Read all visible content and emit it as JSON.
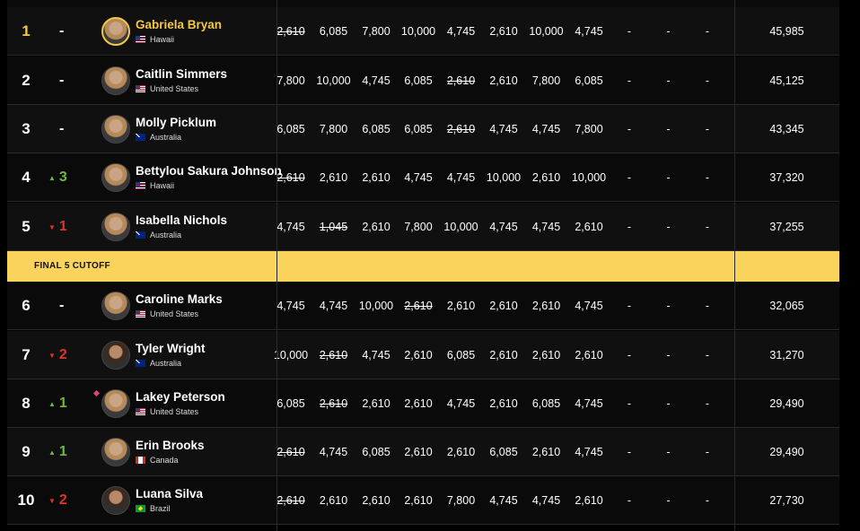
{
  "cutoff_label": "FINAL 5 CUTOFF",
  "athletes": [
    {
      "rank": "1",
      "change_dir": "none",
      "change": "-",
      "name": "Gabriela Bryan",
      "country": "Hawaii",
      "flag": "hawaii",
      "leader": true,
      "marker": false,
      "scores": [
        {
          "v": "2,610",
          "drop": true
        },
        {
          "v": "6,085",
          "drop": false
        },
        {
          "v": "7,800",
          "drop": false
        },
        {
          "v": "10,000",
          "drop": false
        },
        {
          "v": "4,745",
          "drop": false
        },
        {
          "v": "2,610",
          "drop": false
        },
        {
          "v": "10,000",
          "drop": false
        },
        {
          "v": "4,745",
          "drop": false
        },
        {
          "v": "-",
          "drop": false
        },
        {
          "v": "-",
          "drop": false
        },
        {
          "v": "-",
          "drop": false
        }
      ],
      "total": "45,985"
    },
    {
      "rank": "2",
      "change_dir": "none",
      "change": "-",
      "name": "Caitlin Simmers",
      "country": "United States",
      "flag": "us",
      "leader": false,
      "marker": false,
      "scores": [
        {
          "v": "7,800",
          "drop": false
        },
        {
          "v": "10,000",
          "drop": false
        },
        {
          "v": "4,745",
          "drop": false
        },
        {
          "v": "6,085",
          "drop": false
        },
        {
          "v": "2,610",
          "drop": true
        },
        {
          "v": "2,610",
          "drop": false
        },
        {
          "v": "7,800",
          "drop": false
        },
        {
          "v": "6,085",
          "drop": false
        },
        {
          "v": "-",
          "drop": false
        },
        {
          "v": "-",
          "drop": false
        },
        {
          "v": "-",
          "drop": false
        }
      ],
      "total": "45,125"
    },
    {
      "rank": "3",
      "change_dir": "none",
      "change": "-",
      "name": "Molly Picklum",
      "country": "Australia",
      "flag": "au",
      "leader": false,
      "marker": false,
      "scores": [
        {
          "v": "6,085",
          "drop": false
        },
        {
          "v": "7,800",
          "drop": false
        },
        {
          "v": "6,085",
          "drop": false
        },
        {
          "v": "6,085",
          "drop": false
        },
        {
          "v": "2,610",
          "drop": true
        },
        {
          "v": "4,745",
          "drop": false
        },
        {
          "v": "4,745",
          "drop": false
        },
        {
          "v": "7,800",
          "drop": false
        },
        {
          "v": "-",
          "drop": false
        },
        {
          "v": "-",
          "drop": false
        },
        {
          "v": "-",
          "drop": false
        }
      ],
      "total": "43,345"
    },
    {
      "rank": "4",
      "change_dir": "up",
      "change": "3",
      "name": "Bettylou Sakura Johnson",
      "country": "Hawaii",
      "flag": "hawaii",
      "leader": false,
      "marker": false,
      "scores": [
        {
          "v": "2,610",
          "drop": true
        },
        {
          "v": "2,610",
          "drop": false
        },
        {
          "v": "2,610",
          "drop": false
        },
        {
          "v": "4,745",
          "drop": false
        },
        {
          "v": "4,745",
          "drop": false
        },
        {
          "v": "10,000",
          "drop": false
        },
        {
          "v": "2,610",
          "drop": false
        },
        {
          "v": "10,000",
          "drop": false
        },
        {
          "v": "-",
          "drop": false
        },
        {
          "v": "-",
          "drop": false
        },
        {
          "v": "-",
          "drop": false
        }
      ],
      "total": "37,320"
    },
    {
      "rank": "5",
      "change_dir": "down",
      "change": "1",
      "name": "Isabella Nichols",
      "country": "Australia",
      "flag": "au",
      "leader": false,
      "marker": false,
      "scores": [
        {
          "v": "4,745",
          "drop": false
        },
        {
          "v": "1,045",
          "drop": true
        },
        {
          "v": "2,610",
          "drop": false
        },
        {
          "v": "7,800",
          "drop": false
        },
        {
          "v": "10,000",
          "drop": false
        },
        {
          "v": "4,745",
          "drop": false
        },
        {
          "v": "4,745",
          "drop": false
        },
        {
          "v": "2,610",
          "drop": false
        },
        {
          "v": "-",
          "drop": false
        },
        {
          "v": "-",
          "drop": false
        },
        {
          "v": "-",
          "drop": false
        }
      ],
      "total": "37,255"
    },
    {
      "rank": "6",
      "change_dir": "none",
      "change": "-",
      "name": "Caroline Marks",
      "country": "United States",
      "flag": "us",
      "leader": false,
      "marker": false,
      "scores": [
        {
          "v": "4,745",
          "drop": false
        },
        {
          "v": "4,745",
          "drop": false
        },
        {
          "v": "10,000",
          "drop": false
        },
        {
          "v": "2,610",
          "drop": true
        },
        {
          "v": "2,610",
          "drop": false
        },
        {
          "v": "2,610",
          "drop": false
        },
        {
          "v": "2,610",
          "drop": false
        },
        {
          "v": "4,745",
          "drop": false
        },
        {
          "v": "-",
          "drop": false
        },
        {
          "v": "-",
          "drop": false
        },
        {
          "v": "-",
          "drop": false
        }
      ],
      "total": "32,065"
    },
    {
      "rank": "7",
      "change_dir": "down",
      "change": "2",
      "name": "Tyler Wright",
      "country": "Australia",
      "flag": "au",
      "leader": false,
      "marker": false,
      "scores": [
        {
          "v": "10,000",
          "drop": false
        },
        {
          "v": "2,610",
          "drop": true
        },
        {
          "v": "4,745",
          "drop": false
        },
        {
          "v": "2,610",
          "drop": false
        },
        {
          "v": "6,085",
          "drop": false
        },
        {
          "v": "2,610",
          "drop": false
        },
        {
          "v": "2,610",
          "drop": false
        },
        {
          "v": "2,610",
          "drop": false
        },
        {
          "v": "-",
          "drop": false
        },
        {
          "v": "-",
          "drop": false
        },
        {
          "v": "-",
          "drop": false
        }
      ],
      "total": "31,270"
    },
    {
      "rank": "8",
      "change_dir": "up",
      "change": "1",
      "name": "Lakey Peterson",
      "country": "United States",
      "flag": "us",
      "leader": false,
      "marker": true,
      "scores": [
        {
          "v": "6,085",
          "drop": false
        },
        {
          "v": "2,610",
          "drop": true
        },
        {
          "v": "2,610",
          "drop": false
        },
        {
          "v": "2,610",
          "drop": false
        },
        {
          "v": "4,745",
          "drop": false
        },
        {
          "v": "2,610",
          "drop": false
        },
        {
          "v": "6,085",
          "drop": false
        },
        {
          "v": "4,745",
          "drop": false
        },
        {
          "v": "-",
          "drop": false
        },
        {
          "v": "-",
          "drop": false
        },
        {
          "v": "-",
          "drop": false
        }
      ],
      "total": "29,490"
    },
    {
      "rank": "9",
      "change_dir": "up",
      "change": "1",
      "name": "Erin Brooks",
      "country": "Canada",
      "flag": "ca",
      "leader": false,
      "marker": false,
      "scores": [
        {
          "v": "2,610",
          "drop": true
        },
        {
          "v": "4,745",
          "drop": false
        },
        {
          "v": "6,085",
          "drop": false
        },
        {
          "v": "2,610",
          "drop": false
        },
        {
          "v": "2,610",
          "drop": false
        },
        {
          "v": "6,085",
          "drop": false
        },
        {
          "v": "2,610",
          "drop": false
        },
        {
          "v": "4,745",
          "drop": false
        },
        {
          "v": "-",
          "drop": false
        },
        {
          "v": "-",
          "drop": false
        },
        {
          "v": "-",
          "drop": false
        }
      ],
      "total": "29,490"
    },
    {
      "rank": "10",
      "change_dir": "down",
      "change": "2",
      "name": "Luana Silva",
      "country": "Brazil",
      "flag": "br",
      "leader": false,
      "marker": false,
      "scores": [
        {
          "v": "2,610",
          "drop": true
        },
        {
          "v": "2,610",
          "drop": false
        },
        {
          "v": "2,610",
          "drop": false
        },
        {
          "v": "2,610",
          "drop": false
        },
        {
          "v": "7,800",
          "drop": false
        },
        {
          "v": "4,745",
          "drop": false
        },
        {
          "v": "4,745",
          "drop": false
        },
        {
          "v": "2,610",
          "drop": false
        },
        {
          "v": "-",
          "drop": false
        },
        {
          "v": "-",
          "drop": false
        },
        {
          "v": "-",
          "drop": false
        }
      ],
      "total": "27,730"
    }
  ]
}
